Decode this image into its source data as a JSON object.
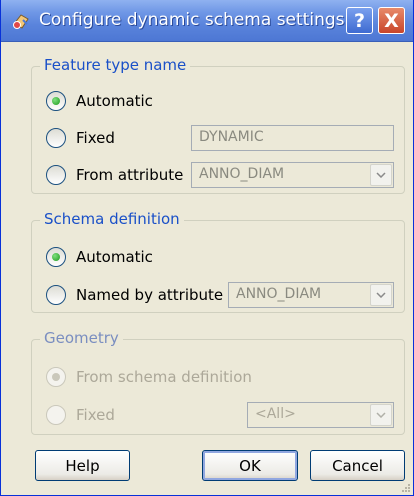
{
  "window": {
    "title": "Configure dynamic schema settings"
  },
  "titlebar_buttons": {
    "help": "?",
    "close": "X"
  },
  "feature_type": {
    "title": "Feature type name",
    "automatic": "Automatic",
    "fixed": "Fixed",
    "fixed_value": "DYNAMIC",
    "from_attribute": "From attribute",
    "attribute_value": "ANNO_DIAM",
    "selected": "automatic"
  },
  "schema_definition": {
    "title": "Schema definition",
    "automatic": "Automatic",
    "named_by_attribute": "Named by attribute",
    "attribute_value": "ANNO_DIAM",
    "selected": "automatic"
  },
  "geometry": {
    "title": "Geometry",
    "from_schema": "From schema definition",
    "fixed": "Fixed",
    "fixed_value": "<All>",
    "selected": "from_schema",
    "enabled": false
  },
  "buttons": {
    "help": "Help",
    "ok": "OK",
    "cancel": "Cancel"
  },
  "colors": {
    "titlebar": "#5a84dc",
    "group_title": "#1a50c8",
    "radio_checked": "#1d9a1d"
  }
}
